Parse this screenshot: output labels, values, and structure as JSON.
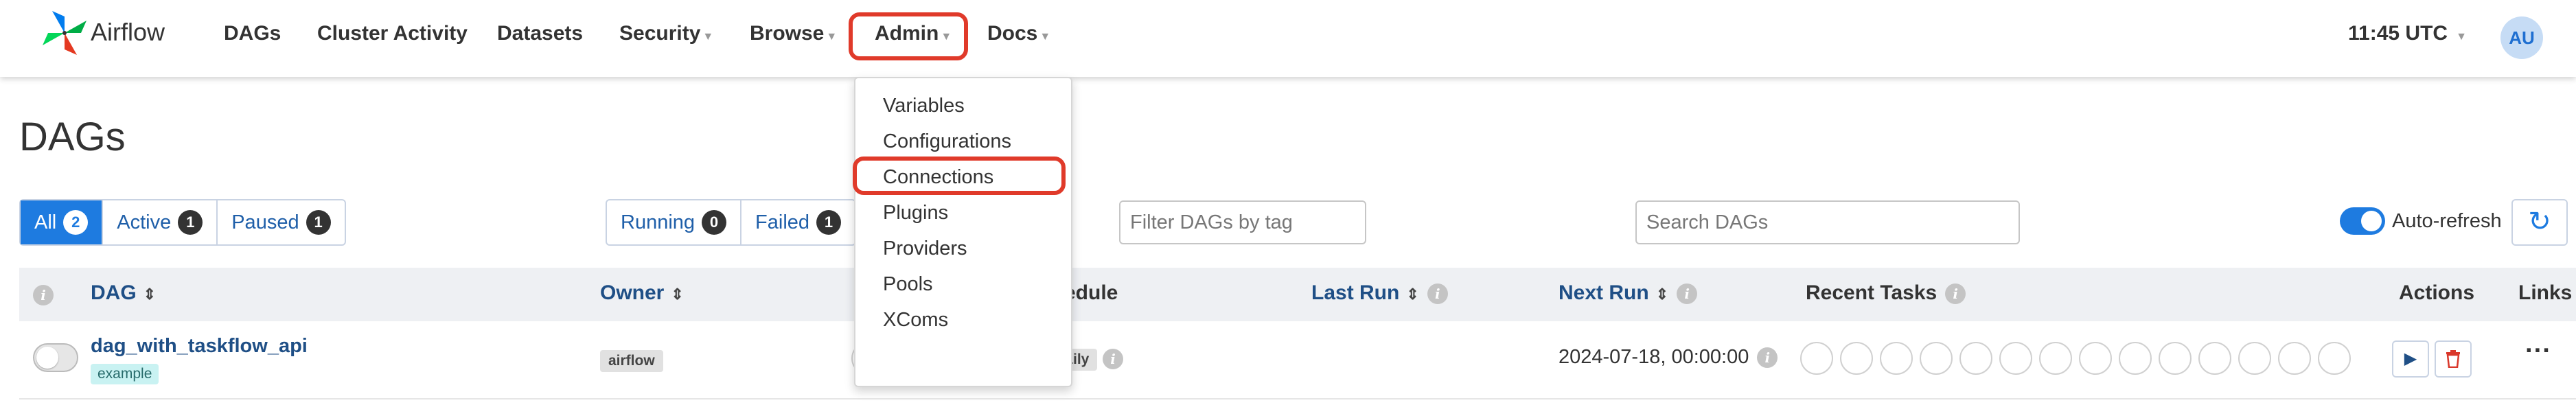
{
  "app": {
    "brand": "Airflow"
  },
  "nav": {
    "dags": "DAGs",
    "cluster_activity": "Cluster Activity",
    "datasets": "Datasets",
    "security": "Security",
    "browse": "Browse",
    "admin": "Admin",
    "docs": "Docs"
  },
  "header": {
    "time": "11:45 UTC",
    "avatar_initials": "AU"
  },
  "page": {
    "title": "DAGs"
  },
  "filters": {
    "all": {
      "label": "All",
      "count": "2"
    },
    "active": {
      "label": "Active",
      "count": "1"
    },
    "paused": {
      "label": "Paused",
      "count": "1"
    },
    "running": {
      "label": "Running",
      "count": "0"
    },
    "failed": {
      "label": "Failed",
      "count": "1"
    }
  },
  "tag_filter": {
    "placeholder": "Filter DAGs by tag"
  },
  "search": {
    "placeholder": "Search DAGs"
  },
  "auto_refresh": {
    "label": "Auto-refresh",
    "enabled": true
  },
  "table": {
    "headers": {
      "dag": "DAG",
      "owner": "Owner",
      "schedule": "edule",
      "last_run": "Last Run",
      "next_run": "Next Run",
      "recent_tasks": "Recent Tasks",
      "actions": "Actions",
      "links": "Links"
    },
    "rows": [
      {
        "dag_id": "dag_with_taskflow_api",
        "tag": "example",
        "owner": "airflow",
        "schedule": "@daily",
        "next_run": "2024-07-18, 00:00:00",
        "paused": true
      }
    ]
  },
  "admin_menu": {
    "items": [
      "Variables",
      "Configurations",
      "Connections",
      "Plugins",
      "Providers",
      "Pools",
      "XComs"
    ],
    "highlighted": "Connections"
  },
  "colors": {
    "accent": "#1e7be0",
    "highlight": "#e03a2a",
    "link": "#1f4f86"
  }
}
